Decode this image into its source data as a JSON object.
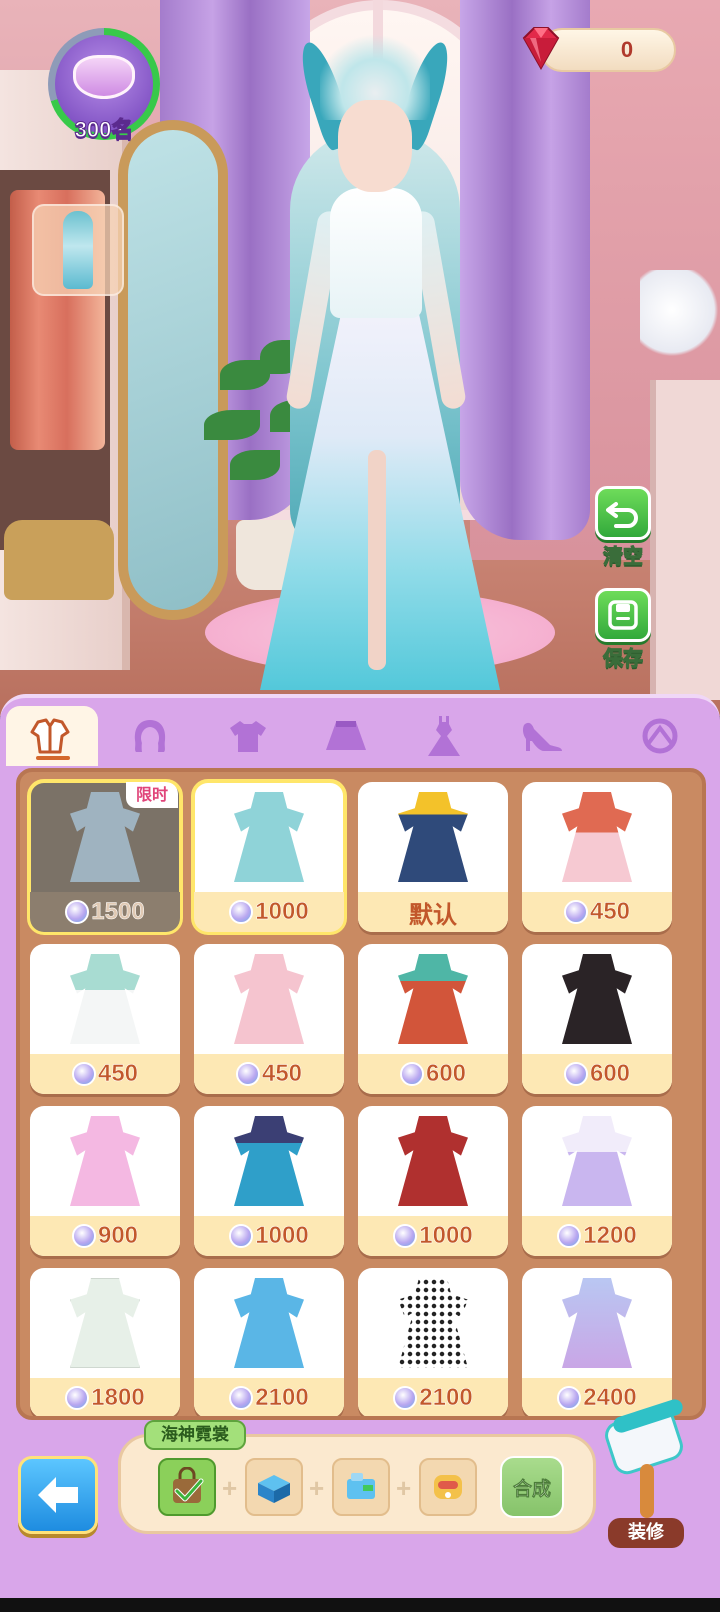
{
  "hud": {
    "rank_label": "300名",
    "gem_count": "0",
    "clear_label": "清空",
    "save_label": "保存"
  },
  "tabs": [
    {
      "name": "outfit",
      "icon": "full-outfit-icon",
      "active": true
    },
    {
      "name": "hair",
      "icon": "hair-icon",
      "active": false
    },
    {
      "name": "top",
      "icon": "shirt-icon",
      "active": false
    },
    {
      "name": "bottom",
      "icon": "skirt-icon",
      "active": false
    },
    {
      "name": "dress",
      "icon": "dress-icon",
      "active": false
    },
    {
      "name": "shoes",
      "icon": "high-heel-icon",
      "active": false
    },
    {
      "name": "accessory",
      "icon": "accessory-icon",
      "active": false
    }
  ],
  "items": [
    {
      "price": "1500",
      "tag": "限时",
      "state": "locked-selected",
      "color": "#8fa6b4"
    },
    {
      "price": "1000",
      "state": "selected",
      "color": "#8fd3d8"
    },
    {
      "price": "默认",
      "state": "default",
      "color": "#2f4a7a"
    },
    {
      "price": "450",
      "state": "normal",
      "color": "#e06a52"
    },
    {
      "price": "450",
      "state": "normal",
      "color": "#a8dcd2"
    },
    {
      "price": "450",
      "state": "normal",
      "color": "#f5c4cf"
    },
    {
      "price": "600",
      "state": "normal",
      "color": "#d2553a"
    },
    {
      "price": "600",
      "state": "normal",
      "color": "#2a2326"
    },
    {
      "price": "900",
      "state": "normal",
      "color": "#f4b8e2"
    },
    {
      "price": "1000",
      "state": "normal",
      "color": "#2f9fc9"
    },
    {
      "price": "1000",
      "state": "normal",
      "color": "#b0302f"
    },
    {
      "price": "1200",
      "state": "normal",
      "color": "#c9b6ef"
    },
    {
      "price": "1800",
      "state": "normal",
      "color": "#e7f0e8"
    },
    {
      "price": "2100",
      "state": "normal",
      "color": "#5ab6e6"
    },
    {
      "price": "2100",
      "state": "normal",
      "color": "#222222"
    },
    {
      "price": "2400",
      "state": "normal",
      "color": "#c9a6e6"
    }
  ],
  "craft": {
    "set_name": "海神霓裳",
    "compose_label": "合成",
    "materials": [
      {
        "icon": "bag-check-icon",
        "owned": true
      },
      {
        "icon": "blue-box-icon",
        "owned": false
      },
      {
        "icon": "blue-machine-icon",
        "owned": false
      },
      {
        "icon": "golden-device-icon",
        "owned": false
      }
    ]
  },
  "decorate_label": "装修",
  "colors": {
    "accent_green": "#3fb545",
    "panel_purple": "#d9a6ea",
    "price_orange": "#c2582b"
  }
}
